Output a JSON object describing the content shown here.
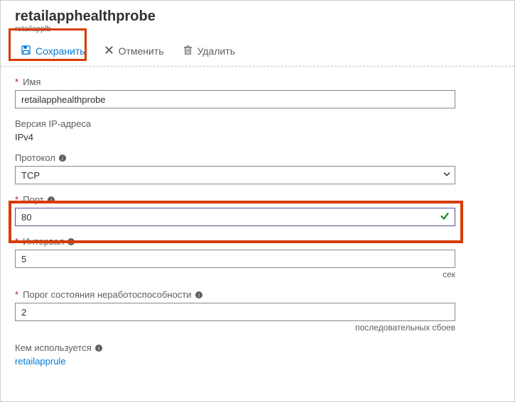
{
  "header": {
    "title": "retailapphealthprobe",
    "subtitle": "retailapplb"
  },
  "toolbar": {
    "save_label": "Сохранить",
    "cancel_label": "Отменить",
    "delete_label": "Удалить"
  },
  "fields": {
    "name": {
      "label": "Имя",
      "value": "retailapphealthprobe"
    },
    "ipversion": {
      "label": "Версия IP-адреса",
      "value": "IPv4"
    },
    "protocol": {
      "label": "Протокол",
      "value": "TCP"
    },
    "port": {
      "label": "Порт",
      "value": "80"
    },
    "interval": {
      "label": "Интервал",
      "value": "5",
      "suffix": "сек"
    },
    "threshold": {
      "label": "Порог состояния неработоспособности",
      "value": "2",
      "suffix": "последовательных сбоев"
    },
    "usedby": {
      "label": "Кем используется",
      "link": "retailapprule"
    }
  }
}
